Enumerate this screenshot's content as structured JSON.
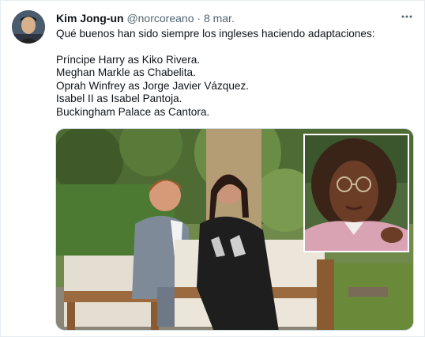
{
  "tweet": {
    "author_name": "Kim Jong-un",
    "handle": "@norcoreano",
    "separator": "·",
    "date": "8 mar.",
    "more_icon": "more-horizontal-icon",
    "lines": [
      "Qué buenos han sido siempre los ingleses haciendo adaptaciones:",
      "Príncipe Harry as Kiko Rivera.",
      "Meghan Markle as Chabelita.",
      "Oprah Winfrey as Jorge Javier Vázquez.",
      "Isabel II as Isabel Pantoja.",
      "Buckingham Palace as Cantora."
    ]
  },
  "colors": {
    "text": "#0f1419",
    "secondary": "#536471",
    "border": "#cfd9de"
  }
}
